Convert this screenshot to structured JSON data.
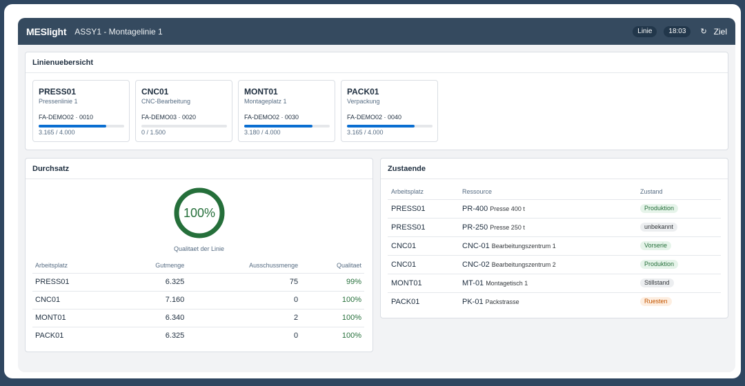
{
  "shell": {
    "brand": "MESlight",
    "title": "ASSY1 - Montagelinie 1",
    "line_pill": "Linie",
    "time": "18:03",
    "refresh_icon": "↻",
    "target": "Ziel"
  },
  "overview": {
    "title": "Linienuebersicht",
    "tiles": [
      {
        "id": "PRESS01",
        "name": "Pressenlinie 1",
        "order": "FA-DEMO02 · 0010",
        "qty": "3.165 / 4.000",
        "progress": 0.79
      },
      {
        "id": "CNC01",
        "name": "CNC-Bearbeitung",
        "order": "FA-DEMO03 · 0020",
        "qty": "0 / 1.500",
        "progress": 0
      },
      {
        "id": "MONT01",
        "name": "Montageplatz 1",
        "order": "FA-DEMO02 · 0030",
        "qty": "3.180 / 4.000",
        "progress": 0.795
      },
      {
        "id": "PACK01",
        "name": "Verpackung",
        "order": "FA-DEMO02 · 0040",
        "qty": "3.165 / 4.000",
        "progress": 0.79
      }
    ]
  },
  "throughput": {
    "title": "Durchsatz",
    "quality_value": "100%",
    "quality_fraction": 1.0,
    "quality_label": "Qualitaet der Linie",
    "columns": [
      "Arbeitsplatz",
      "Gutmenge",
      "Ausschussmenge",
      "Qualitaet"
    ],
    "rows": [
      {
        "ws": "PRESS01",
        "good": "6.325",
        "scrap": "75",
        "quality": "99%"
      },
      {
        "ws": "CNC01",
        "good": "7.160",
        "scrap": "0",
        "quality": "100%"
      },
      {
        "ws": "MONT01",
        "good": "6.340",
        "scrap": "2",
        "quality": "100%"
      },
      {
        "ws": "PACK01",
        "good": "6.325",
        "scrap": "0",
        "quality": "100%"
      }
    ]
  },
  "states": {
    "title": "Zustaende",
    "columns": [
      "Arbeitsplatz",
      "Ressource",
      "Zustand"
    ],
    "rows": [
      {
        "ws": "PRESS01",
        "res": "PR-400",
        "desc": "Presse 400 t",
        "state": "Produktion",
        "color": "#256f3a"
      },
      {
        "ws": "PRESS01",
        "res": "PR-250",
        "desc": "Presse 250 t",
        "state": "unbekannt",
        "color": "#32363a"
      },
      {
        "ws": "CNC01",
        "res": "CNC-01",
        "desc": "Bearbeitungszentrum 1",
        "state": "Vorserie",
        "color": "#256f3a"
      },
      {
        "ws": "CNC01",
        "res": "CNC-02",
        "desc": "Bearbeitungszentrum 2",
        "state": "Produktion",
        "color": "#256f3a"
      },
      {
        "ws": "MONT01",
        "res": "MT-01",
        "desc": "Montagetisch 1",
        "state": "Stillstand",
        "color": "#32363a"
      },
      {
        "ws": "PACK01",
        "res": "PK-01",
        "desc": "Packstrasse",
        "state": "Ruesten",
        "color": "#c35500"
      }
    ]
  }
}
